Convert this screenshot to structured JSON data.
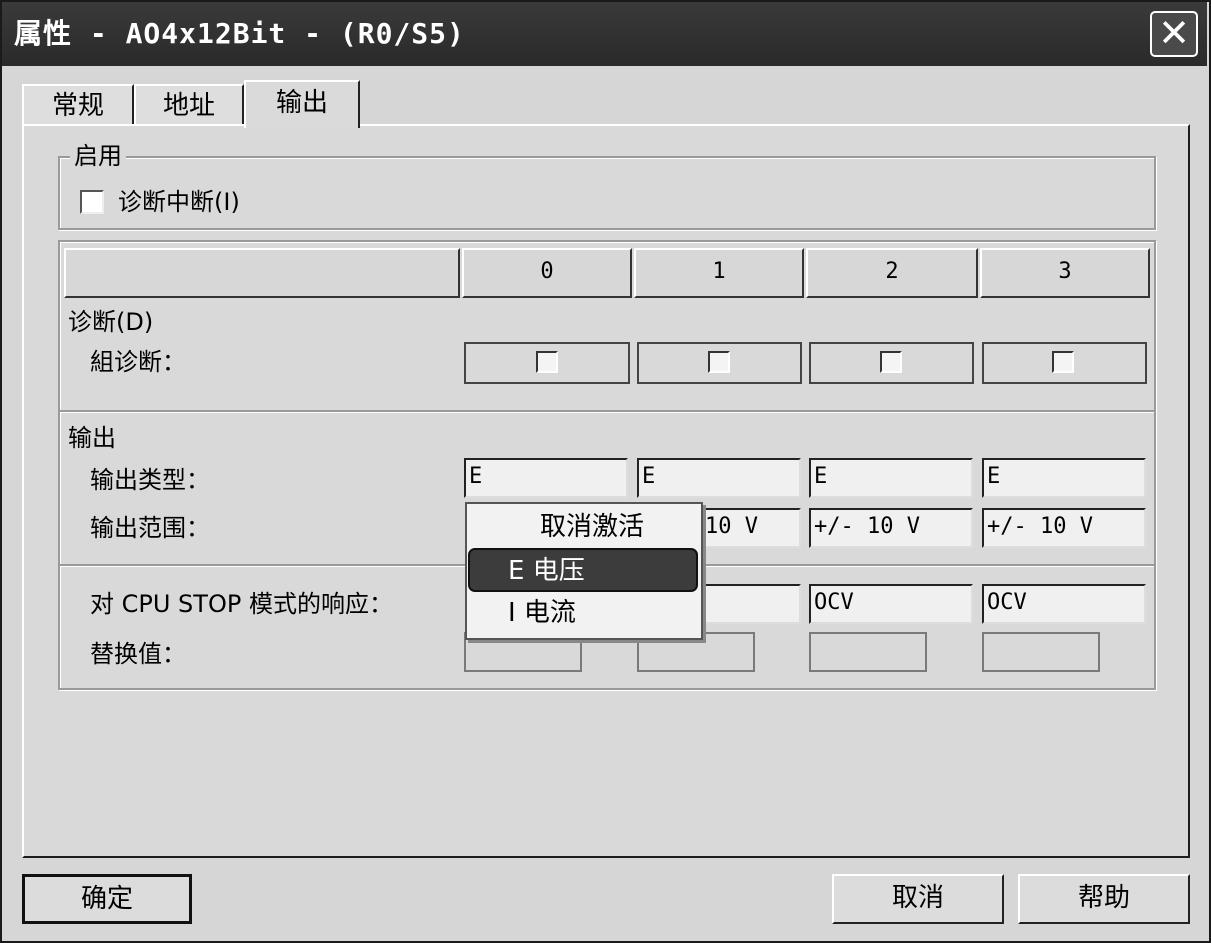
{
  "window": {
    "title": "属性 - AO4x12Bit - (R0/S5)",
    "close_glyph": "✕"
  },
  "tabs": [
    {
      "label": "常规"
    },
    {
      "label": "地址"
    },
    {
      "label": "输出",
      "active": true
    }
  ],
  "enable_group": {
    "legend": "启用",
    "diag_interrupt": {
      "label": "诊断中断(I)",
      "checked": false
    }
  },
  "channel_grid": {
    "columns": [
      "0",
      "1",
      "2",
      "3"
    ],
    "diagnostics": {
      "section_label": "诊断(D)",
      "group_diag_label": "組诊断：",
      "group_diag_checked": [
        false,
        false,
        false,
        false
      ]
    },
    "output": {
      "section_label": "输出",
      "type_label": "输出类型：",
      "type_values": [
        "E",
        "E",
        "E",
        "E"
      ],
      "range_label": "输出范围：",
      "range_values": [
        "10 V",
        "+/- 10 V",
        "+/- 10 V"
      ]
    },
    "cpu_stop": {
      "response_label": "对 CPU STOP 模式的响应：",
      "response_values": [
        "",
        "OCV",
        "OCV"
      ],
      "substitute_label": "替换值：",
      "substitute_values": [
        "",
        "",
        "",
        ""
      ]
    }
  },
  "context_menu": {
    "items": [
      {
        "label": "取消激活"
      },
      {
        "label": "E 电压",
        "selected": true
      },
      {
        "label": "I 电流"
      }
    ]
  },
  "buttons": {
    "ok": "确定",
    "cancel": "取消",
    "help": "帮助"
  }
}
